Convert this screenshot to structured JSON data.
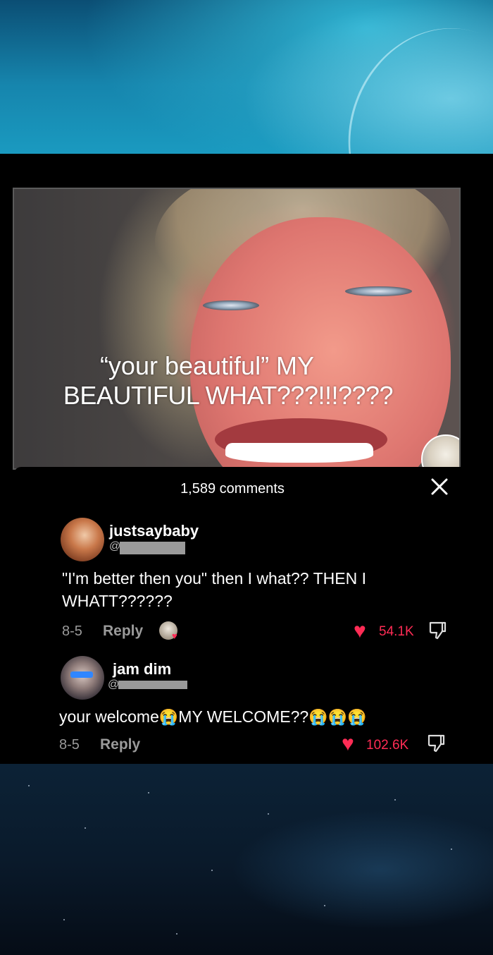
{
  "video": {
    "caption_line1": "“your beautiful” MY",
    "caption_line2": "BEAUTIFUL WHAT???!!!????",
    "follow_icon": "plus"
  },
  "comments_panel": {
    "count_label": "1,589 comments",
    "close_icon": "x",
    "items": [
      {
        "username": "justsaybaby",
        "handle_prefix": "@",
        "text_line1": "\"I'm better then you\" then I what?? THEN I",
        "text_line2": "WHATT??????",
        "date": "8-5",
        "reply_label": "Reply",
        "likes": "54.1K"
      },
      {
        "username": "jam dim",
        "handle_prefix": "@",
        "text_part1": "your welcome",
        "text_part2": "MY WELCOME??",
        "emoji": "😭",
        "date": "8-5",
        "reply_label": "Reply",
        "likes": "102.6K"
      }
    ]
  },
  "colors": {
    "accent": "#fe2c55",
    "panel_bg": "#000000",
    "muted_text": "#9a9a9a"
  }
}
